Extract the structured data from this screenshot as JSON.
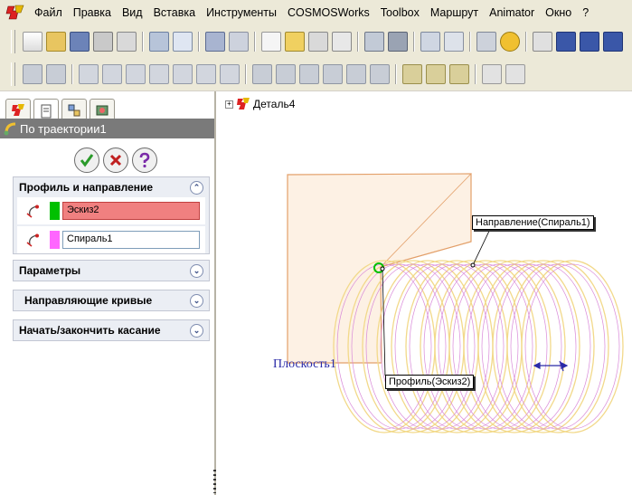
{
  "menubar": {
    "items": [
      "Файл",
      "Правка",
      "Вид",
      "Вставка",
      "Инструменты",
      "COSMOSWorks",
      "Toolbox",
      "Маршрут",
      "Animator",
      "Окно",
      "?"
    ]
  },
  "left_panel": {
    "feature_title": "По траектории1",
    "sections": {
      "profile_path": {
        "title": "Профиль и направление",
        "profile_value": "Эскиз2",
        "path_value": "Спираль1"
      },
      "options": {
        "title": "Параметры"
      },
      "guide_curves": {
        "title": "Направляющие кривые"
      },
      "tangency": {
        "title": "Начать/закончить касание"
      }
    }
  },
  "canvas": {
    "tree_root": "Деталь4",
    "callout_path": "Направление(Спираль1)",
    "callout_profile": "Профиль(Эскиз2)",
    "plane_label": "Плоскость1"
  },
  "colors": {
    "profile_swatch": "#00c000",
    "profile_field_bg": "#f08080",
    "path_swatch": "#ff66ff",
    "coil": "#f2d98a",
    "coil_inner": "#d98ad9",
    "plane_edge": "#e3a06a"
  }
}
